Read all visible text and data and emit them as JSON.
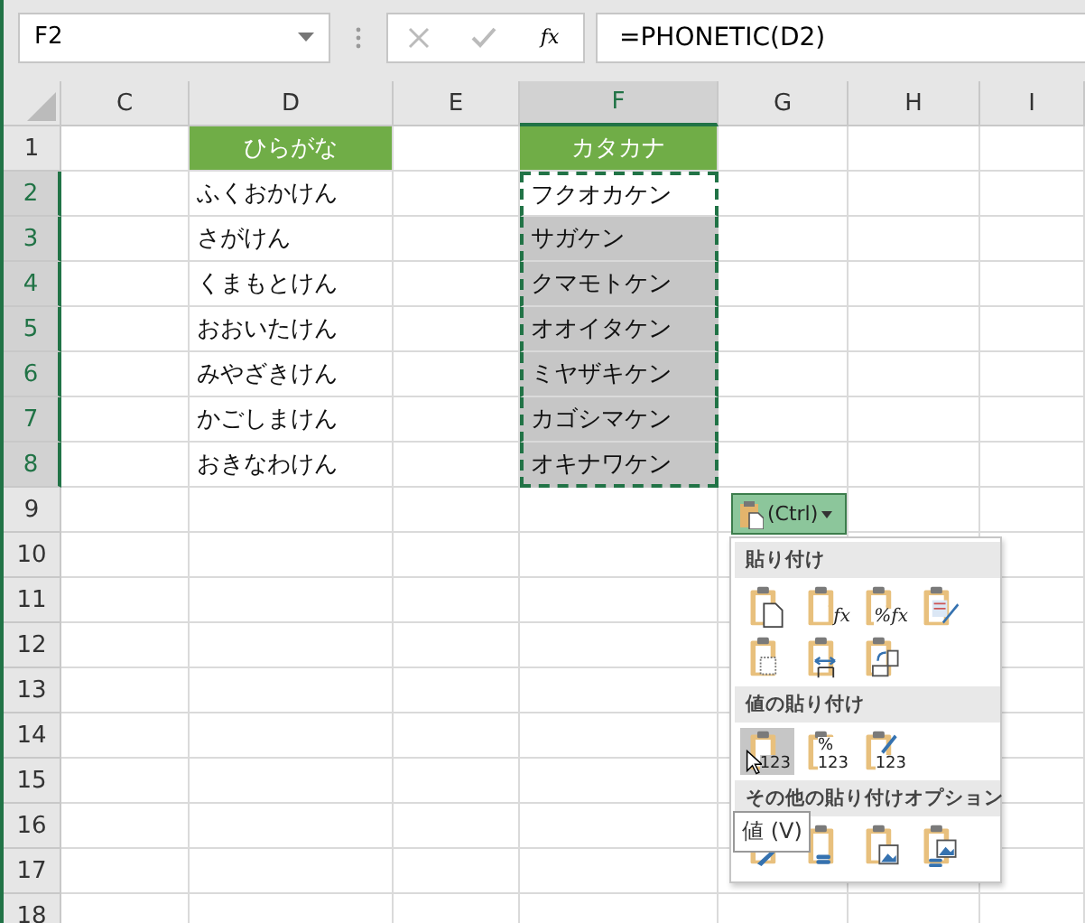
{
  "name_box": "F2",
  "function_button": "fx",
  "formula": "=PHONETIC(D2)",
  "columns": [
    {
      "label": "C",
      "selected": false
    },
    {
      "label": "D",
      "selected": false
    },
    {
      "label": "E",
      "selected": false
    },
    {
      "label": "F",
      "selected": true
    },
    {
      "label": "G",
      "selected": false
    },
    {
      "label": "H",
      "selected": false
    },
    {
      "label": "I",
      "selected": false
    }
  ],
  "rows": [
    {
      "label": "1",
      "kind": "header",
      "selected": false,
      "d": "ひらがな",
      "f": "カタカナ"
    },
    {
      "label": "2",
      "kind": "data",
      "selected": true,
      "active": true,
      "d": "ふくおかけん",
      "f": "フクオカケン"
    },
    {
      "label": "3",
      "kind": "data",
      "selected": true,
      "active": false,
      "d": "さがけん",
      "f": "サガケン"
    },
    {
      "label": "4",
      "kind": "data",
      "selected": true,
      "active": false,
      "d": "くまもとけん",
      "f": "クマモトケン"
    },
    {
      "label": "5",
      "kind": "data",
      "selected": true,
      "active": false,
      "d": "おおいたけん",
      "f": "オオイタケン"
    },
    {
      "label": "6",
      "kind": "data",
      "selected": true,
      "active": false,
      "d": "みやざきけん",
      "f": "ミヤザキケン"
    },
    {
      "label": "7",
      "kind": "data",
      "selected": true,
      "active": false,
      "d": "かごしまけん",
      "f": "カゴシマケン"
    },
    {
      "label": "8",
      "kind": "data",
      "selected": true,
      "active": false,
      "d": "おきなわけん",
      "f": "オキナワケン"
    },
    {
      "label": "9",
      "selected": false
    },
    {
      "label": "10",
      "selected": false
    },
    {
      "label": "11",
      "selected": false
    },
    {
      "label": "12",
      "selected": false
    },
    {
      "label": "13",
      "selected": false
    },
    {
      "label": "14",
      "selected": false
    },
    {
      "label": "15",
      "selected": false
    },
    {
      "label": "16",
      "selected": false
    },
    {
      "label": "17",
      "selected": false
    },
    {
      "label": "18",
      "selected": false
    }
  ],
  "paste_button": {
    "label": "(Ctrl)"
  },
  "paste_menu": {
    "sections": [
      {
        "title": "貼り付け",
        "items": [
          {
            "kind": "paste",
            "selected": false
          },
          {
            "kind": "formula",
            "glyph": "fx",
            "selected": false
          },
          {
            "kind": "formula",
            "glyph": "%fx",
            "selected": false
          },
          {
            "kind": "source",
            "selected": false
          },
          {
            "kind": "noborder",
            "selected": false
          },
          {
            "kind": "widths",
            "selected": false
          },
          {
            "kind": "transpose",
            "selected": false
          }
        ]
      },
      {
        "title": "値の貼り付け",
        "items": [
          {
            "kind": "values",
            "glyph": "123",
            "selected": true
          },
          {
            "kind": "values",
            "glyph": "%",
            "glyph2": "123",
            "selected": false
          },
          {
            "kind": "valuesbrush",
            "glyph": "123",
            "selected": false
          }
        ]
      },
      {
        "title": "その他の貼り付けオプション",
        "items": [
          {
            "kind": "brush",
            "selected": false
          },
          {
            "kind": "link",
            "selected": false
          },
          {
            "kind": "picture",
            "selected": false
          },
          {
            "kind": "linkpicture",
            "selected": false
          }
        ]
      }
    ]
  },
  "tooltip": "値 (V)"
}
